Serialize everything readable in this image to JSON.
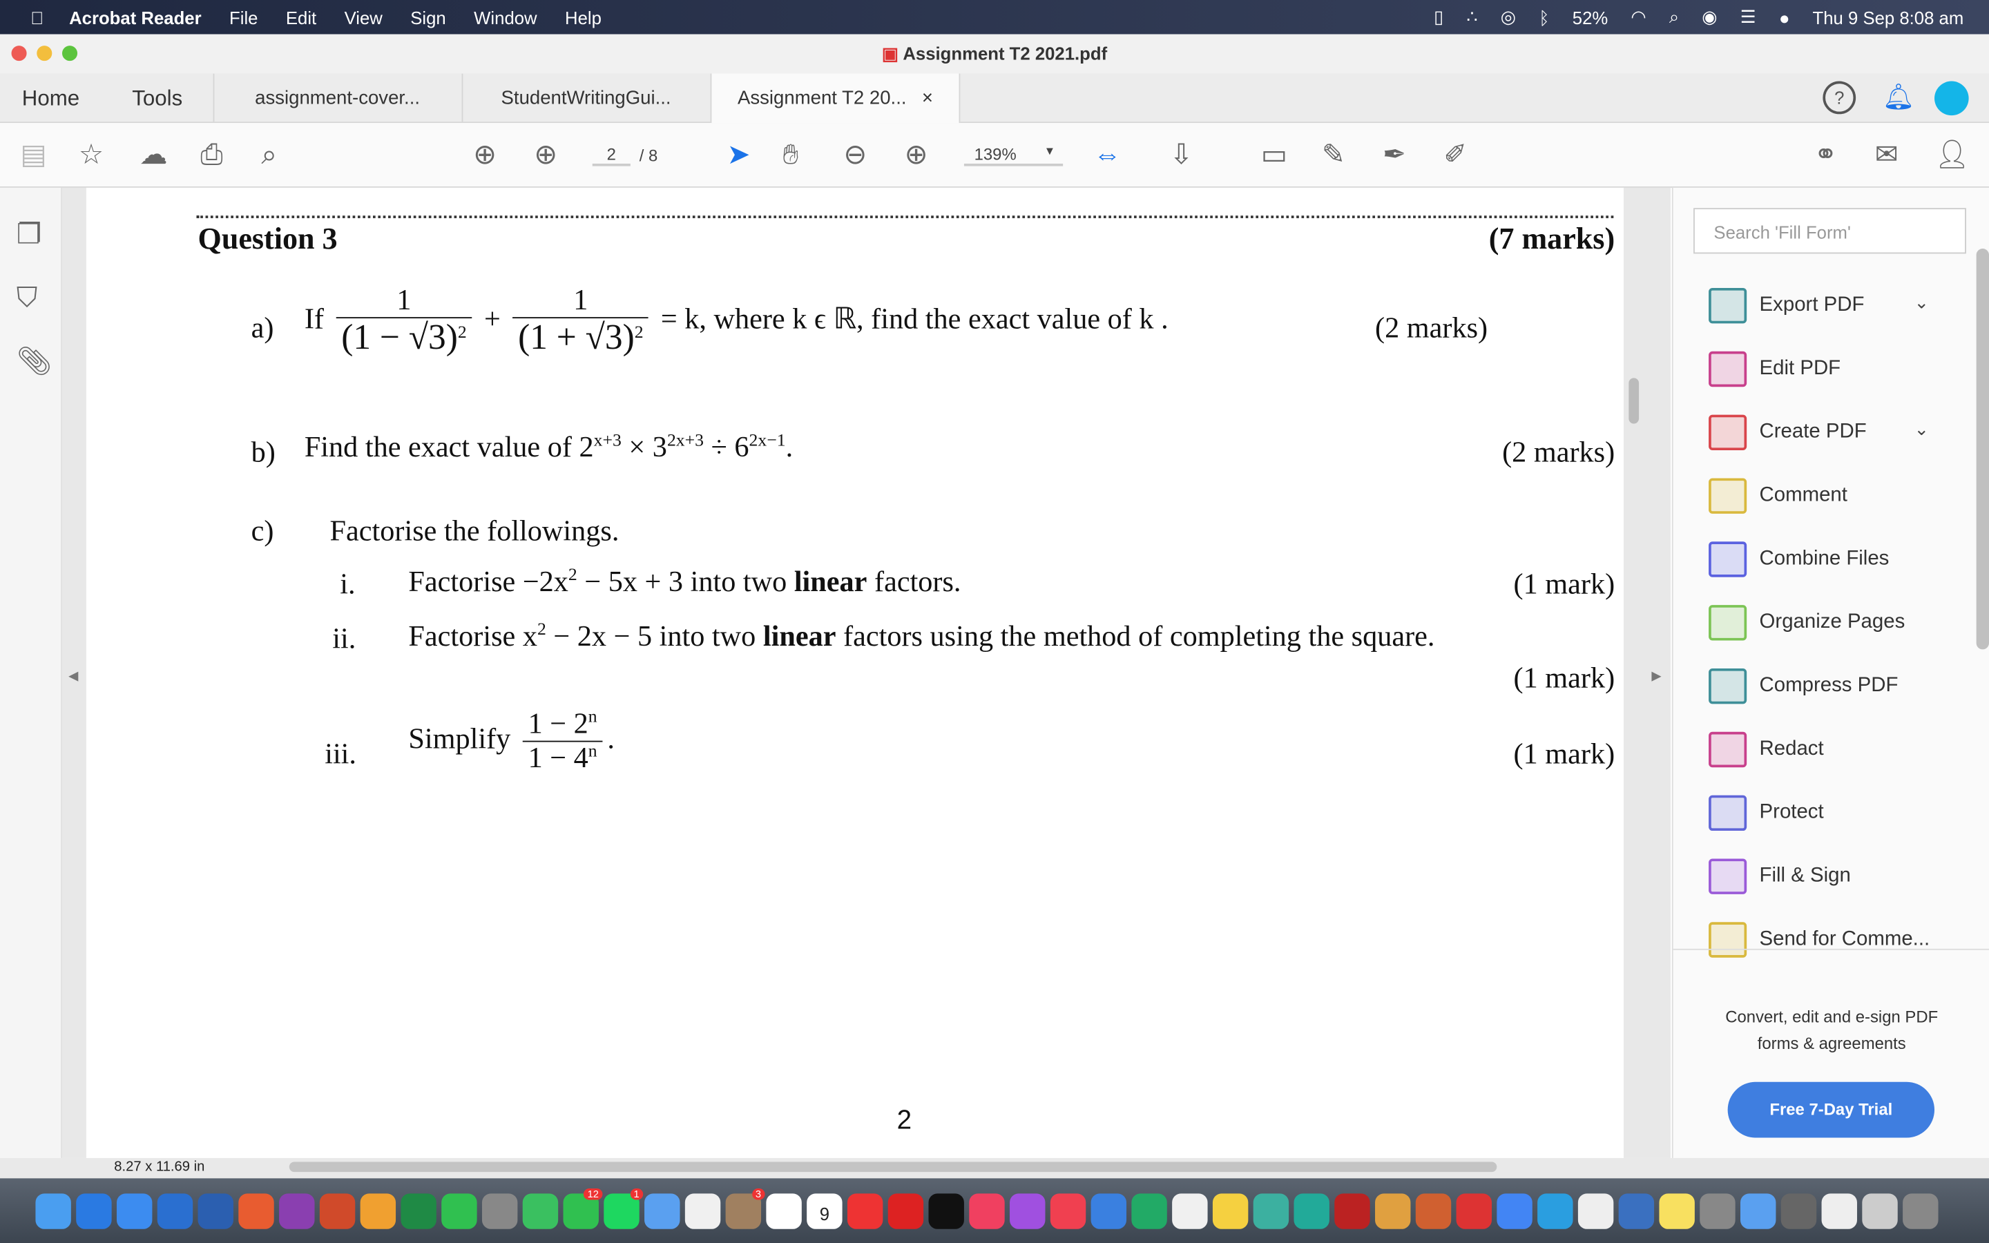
{
  "menubar": {
    "app": "Acrobat Reader",
    "items": [
      "File",
      "Edit",
      "View",
      "Sign",
      "Window",
      "Help"
    ],
    "battery": "52%",
    "datetime": "Thu 9 Sep  8:08 am"
  },
  "window": {
    "title": "Assignment T2 2021.pdf"
  },
  "tabs": {
    "home": "Home",
    "tools": "Tools",
    "docs": [
      "assignment-cover...",
      "StudentWritingGui...",
      "Assignment T2 20..."
    ],
    "close": "×"
  },
  "toolbar": {
    "page_current": "2",
    "page_total": "/ 8",
    "zoom": "139%"
  },
  "document": {
    "question": "Question 3",
    "total_marks": "(7 marks)",
    "a": {
      "label": "a)",
      "if": "If",
      "one": "1",
      "den1": "(1 − √3)",
      "den2": "(1 + √3)",
      "sq": "2",
      "plus": "+",
      "eq": "= k",
      "rest": ", where k ϵ ℝ, find the exact value of k .",
      "marks": "(2 marks)"
    },
    "b": {
      "label": "b)",
      "text": "Find the exact value of 2",
      "e1": "x+3",
      "t2": " × 3",
      "e2": "2x+3",
      "t3": " ÷ 6",
      "e3": "2x−1",
      "end": ".",
      "marks": "(2 marks)"
    },
    "c": {
      "label": "c)",
      "text": "Factorise the followings.",
      "i": {
        "label": "i.",
        "pre": "Factorise −2x",
        "sq": "2",
        "mid": " − 5x + 3 into two ",
        "bold": "linear",
        "post": " factors.",
        "marks": "(1 mark)"
      },
      "ii": {
        "label": "ii.",
        "pre": "Factorise x",
        "sq": "2",
        "mid": " − 2x − 5 into two ",
        "bold": "linear",
        "post": " factors using the method of completing the square.",
        "marks": "(1 mark)"
      },
      "iii": {
        "label": "iii.",
        "pre": "Simplify",
        "num": "1 − 2",
        "den": "1 − 4",
        "n": "n",
        "end": ".",
        "marks": "(1 mark)"
      }
    },
    "page_number": "2"
  },
  "rightpane": {
    "search_placeholder": "Search 'Fill Form'",
    "tools": [
      {
        "label": "Export PDF",
        "color": "#3e8f98"
      },
      {
        "label": "Edit PDF",
        "color": "#c8408c"
      },
      {
        "label": "Create PDF",
        "color": "#d9454b"
      },
      {
        "label": "Comment",
        "color": "#d9b93e"
      },
      {
        "label": "Combine Files",
        "color": "#5b62e0"
      },
      {
        "label": "Organize Pages",
        "color": "#7cc455"
      },
      {
        "label": "Compress PDF",
        "color": "#3e8f98"
      },
      {
        "label": "Redact",
        "color": "#c8408c"
      },
      {
        "label": "Protect",
        "color": "#6066d8"
      },
      {
        "label": "Fill & Sign",
        "color": "#9a5ad8"
      },
      {
        "label": "Send for Comme...",
        "color": "#d9b93e"
      }
    ],
    "promo": "Convert, edit and e-sign PDF forms & agreements",
    "trial": "Free 7-Day Trial"
  },
  "statusbar": {
    "size": "8.27 x 11.69 in"
  },
  "dock": {
    "badges": {
      "messages": "12",
      "facetime": "1",
      "reminders": "3"
    },
    "calendar": "9"
  }
}
